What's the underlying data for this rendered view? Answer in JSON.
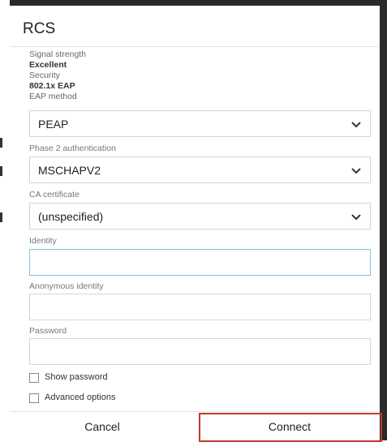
{
  "dialog": {
    "title": "RCS",
    "signal_label": "Signal strength",
    "signal_value": "Excellent",
    "security_label": "Security",
    "security_value": "802.1x EAP",
    "eap_label": "EAP method",
    "eap_value": "PEAP",
    "phase2_label": "Phase 2 authentication",
    "phase2_value": "MSCHAPV2",
    "ca_label": "CA certificate",
    "ca_value": "(unspecified)",
    "identity_label": "Identity",
    "identity_value": "",
    "anon_label": "Anonymous identity",
    "anon_value": "",
    "password_label": "Password",
    "password_value": "",
    "show_password_label": "Show password",
    "advanced_label": "Advanced options",
    "cancel_label": "Cancel",
    "connect_label": "Connect"
  },
  "colors": {
    "highlight": "#c0392b",
    "focus_border": "#7fc3d4"
  },
  "icons": {
    "dropdown": "chevron-down-icon",
    "checkbox": "checkbox-icon"
  }
}
